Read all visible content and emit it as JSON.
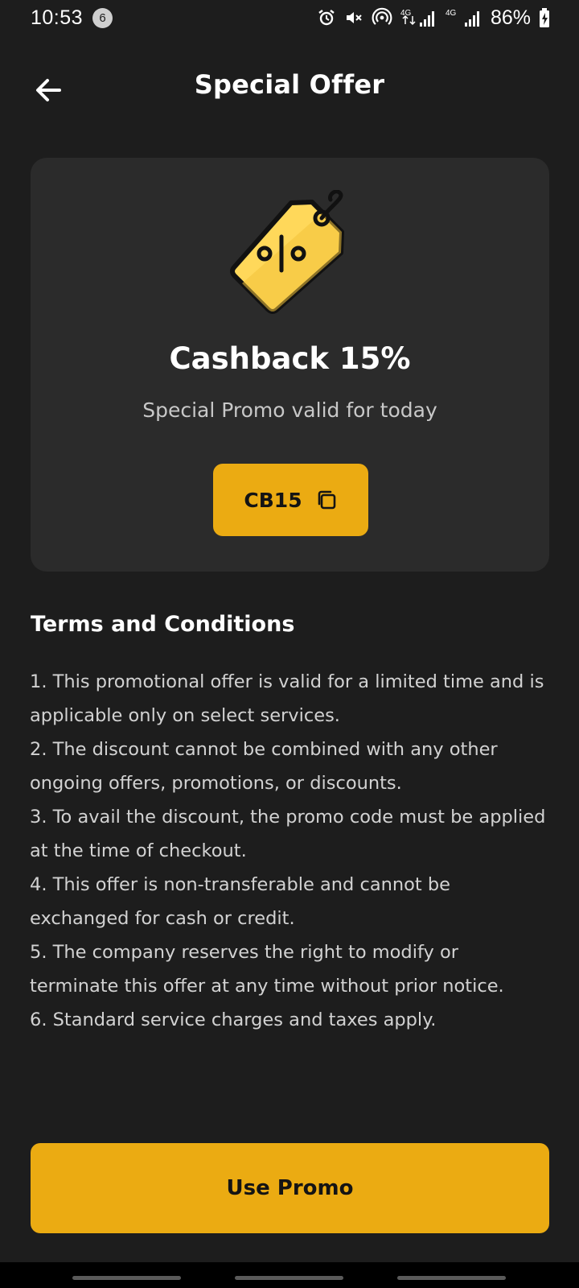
{
  "status_bar": {
    "time": "10:53",
    "notification_count": "6",
    "network_label_1": "4G",
    "network_label_2": "4G",
    "battery_percent": "86%"
  },
  "header": {
    "title": "Special Offer",
    "back_icon": "arrow-left-icon"
  },
  "offer": {
    "illustration_icon": "percent-tag-icon",
    "title": "Cashback 15%",
    "subtitle": "Special Promo valid for today",
    "promo_code": "CB15",
    "copy_icon": "copy-icon"
  },
  "terms": {
    "heading": "Terms and Conditions",
    "items": [
      "1. This promotional offer is valid for a limited time and is applicable only on select services.",
      "2. The discount cannot be combined with any other ongoing offers, promotions, or discounts.",
      "3. To avail the discount, the promo code must be applied at the time of checkout.",
      "4. This offer is non-transferable and cannot be exchanged for cash or credit.",
      "5. The company reserves the right to modify or terminate this offer at any time without prior notice.",
      "6. Standard service charges and taxes apply."
    ]
  },
  "actions": {
    "use_promo_label": "Use Promo"
  },
  "colors": {
    "background": "#1d1d1d",
    "card": "#2b2b2b",
    "accent": "#ebab12",
    "tag_fill": "#ffd85a"
  }
}
